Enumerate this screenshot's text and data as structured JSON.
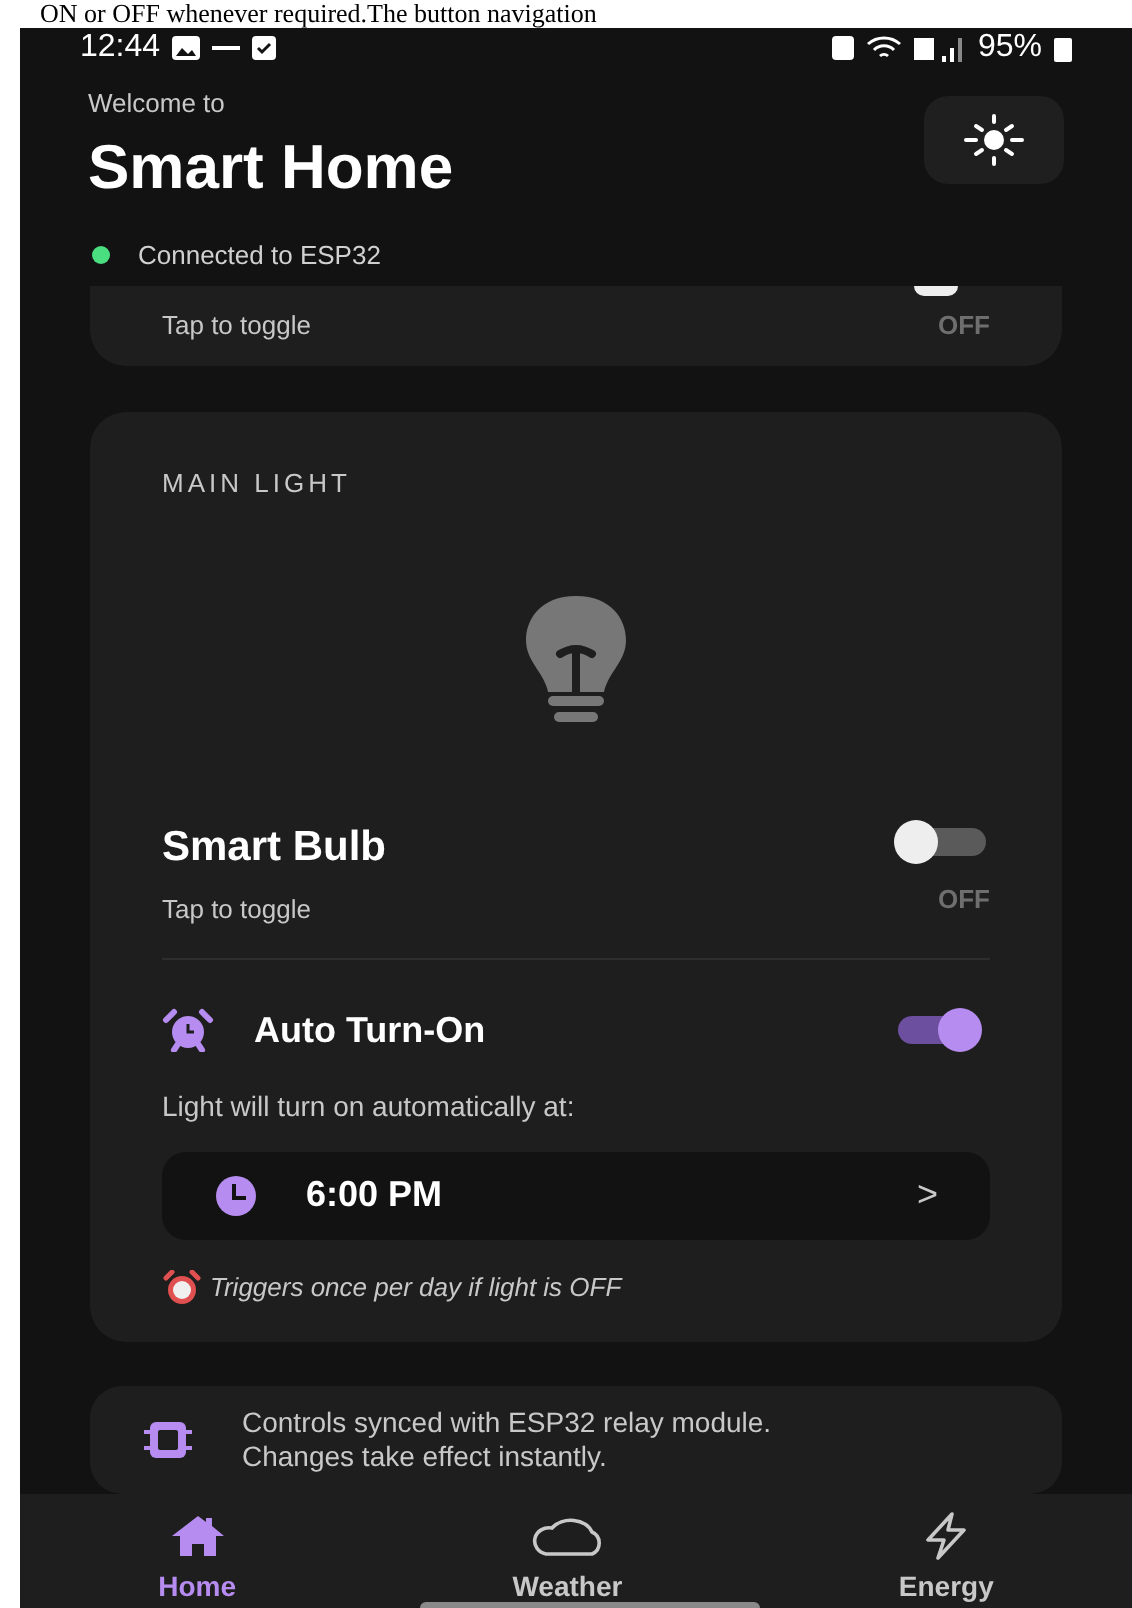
{
  "caption": "ON or OFF whenever required.The button navigation",
  "status_bar": {
    "time": "12:44",
    "battery": "95%"
  },
  "header": {
    "subtitle": "Welcome to",
    "title": "Smart Home",
    "connection": {
      "label": "Connected to ESP32",
      "color": "#4ade80"
    }
  },
  "fan_card": {
    "hint": "Tap to toggle",
    "on": false,
    "state_label": "OFF"
  },
  "light_card": {
    "section": "MAIN LIGHT",
    "device": "Smart Bulb",
    "hint": "Tap to toggle",
    "on": false,
    "state_label": "OFF",
    "auto": {
      "label": "Auto Turn-On",
      "on": true,
      "description": "Light will turn on automatically at:",
      "time": "6:00 PM",
      "chevron": ">",
      "note": "Triggers once per day if light is OFF"
    }
  },
  "info": "Controls synced with ESP32 relay module.\nChanges take effect instantly.",
  "nav": [
    {
      "label": "Home",
      "selected": true
    },
    {
      "label": "Weather",
      "selected": false
    },
    {
      "label": "Energy",
      "selected": false
    }
  ]
}
